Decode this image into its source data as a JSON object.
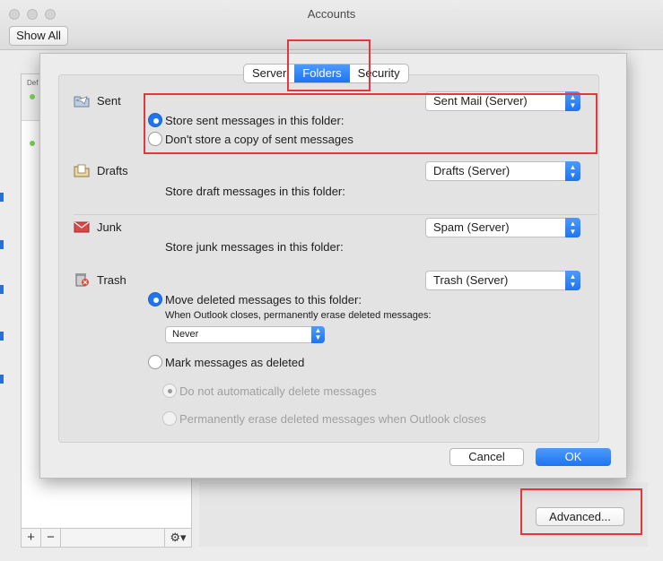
{
  "window": {
    "title": "Accounts",
    "show_all_label": "Show All",
    "list_header_fragment": "Def",
    "add_glyph": "+",
    "remove_glyph": "−",
    "gear_glyph": "⚙▾",
    "advanced_label": "Advanced..."
  },
  "sheet": {
    "tabs": [
      {
        "label": "Server",
        "active": false
      },
      {
        "label": "Folders",
        "active": true
      },
      {
        "label": "Security",
        "active": false
      }
    ],
    "sent": {
      "label": "Sent",
      "icon": "sent-folder-icon",
      "folder": "Sent Mail (Server)",
      "options": [
        {
          "label": "Store sent messages in this folder:",
          "selected": true
        },
        {
          "label": "Don't store a copy of sent messages",
          "selected": false
        }
      ]
    },
    "drafts": {
      "label": "Drafts",
      "icon": "drafts-folder-icon",
      "folder": "Drafts (Server)",
      "description": "Store draft messages in this folder:"
    },
    "junk": {
      "label": "Junk",
      "icon": "junk-envelope-icon",
      "folder": "Spam (Server)",
      "description": "Store junk messages in this folder:"
    },
    "trash": {
      "label": "Trash",
      "icon": "trash-can-icon",
      "folder": "Trash (Server)",
      "move_option": "Move deleted messages to this folder:",
      "erase_note": "When Outlook closes, permanently erase deleted messages:",
      "erase_value": "Never",
      "mark_option": "Mark messages as deleted",
      "sub_options": [
        "Do not automatically delete messages",
        "Permanently erase deleted messages when Outlook closes"
      ]
    },
    "cancel_label": "Cancel",
    "ok_label": "OK"
  },
  "colors": {
    "accent": "#1f74f0",
    "highlight_box": "#e8353b"
  }
}
